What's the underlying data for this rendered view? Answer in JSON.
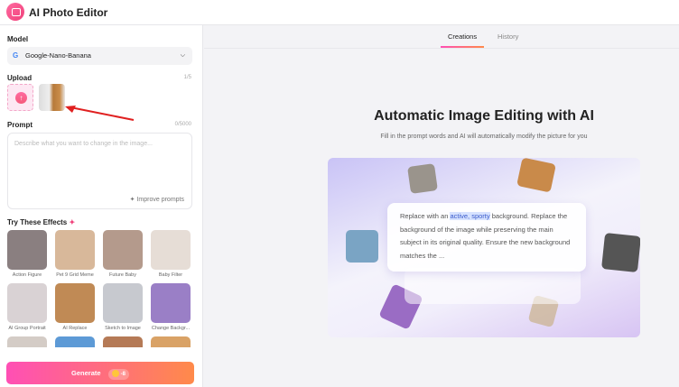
{
  "app": {
    "title": "AI Photo Editor"
  },
  "sidebar": {
    "model_label": "Model",
    "model_value": "Google-Nano-Banana",
    "upload_label": "Upload",
    "upload_count": "1/5",
    "prompt_label": "Prompt",
    "prompt_count": "0/5000",
    "prompt_placeholder": "Describe what you want to change in the image...",
    "improve_label": "Improve prompts",
    "effects_title": "Try These Effects",
    "effects": [
      {
        "label": "Action Figure",
        "color": "#8a7f80"
      },
      {
        "label": "Pet 9 Grid Meme",
        "color": "#d8b89a"
      },
      {
        "label": "Future Baby",
        "color": "#b49a8c"
      },
      {
        "label": "Baby Filter",
        "color": "#e6ddd6"
      },
      {
        "label": "AI Group Portrait",
        "color": "#d9d2d4"
      },
      {
        "label": "AI Replace",
        "color": "#c08a55"
      },
      {
        "label": "Sketch to Image",
        "color": "#c7c9cf"
      },
      {
        "label": "Change Backgr...",
        "color": "#9a7fc6"
      },
      {
        "label": "",
        "color": "#d4ccc6"
      },
      {
        "label": "",
        "color": "#5d9ad6"
      },
      {
        "label": "",
        "color": "#b57a56"
      },
      {
        "label": "",
        "color": "#d9a266"
      }
    ],
    "generate_label": "Generate",
    "generate_cost": "-8"
  },
  "main": {
    "tabs": [
      {
        "label": "Creations",
        "active": true
      },
      {
        "label": "History",
        "active": false
      }
    ],
    "title": "Automatic Image Editing with AI",
    "subtitle": "Fill in the prompt words and AI will automatically modify the picture for you",
    "demo": {
      "pre": "Replace with an ",
      "highlight": "active, sporty",
      "post": " background. Replace the background of the image while preserving the main subject in its original quality. Ensure the new background matches the ..."
    }
  },
  "colors": {
    "accent_start": "#ff4fb5",
    "accent_end": "#ff8a4a"
  }
}
